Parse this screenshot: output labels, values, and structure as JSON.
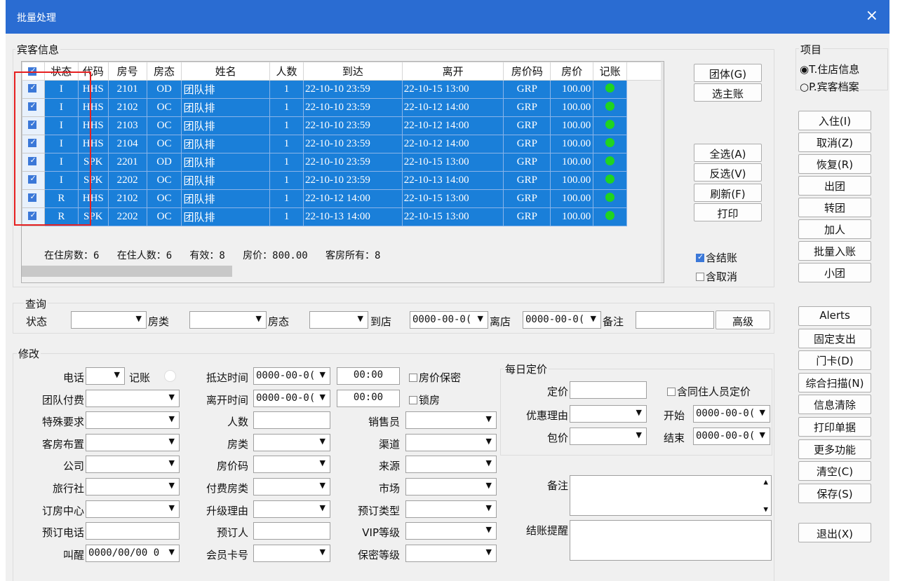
{
  "window": {
    "title": "批量处理",
    "close": "×"
  },
  "guest": {
    "legend": "宾客信息",
    "columns": [
      "状态",
      "代码",
      "房号",
      "房态",
      "姓名",
      "人数",
      "到达",
      "离开",
      "房价码",
      "房价",
      "记账"
    ],
    "rows": [
      [
        "I",
        "HHS",
        "2101",
        "OD",
        "团队排",
        "1",
        "22-10-10 23:59",
        "22-10-15 13:00",
        "GRP",
        "100.00"
      ],
      [
        "I",
        "HHS",
        "2102",
        "OC",
        "团队排",
        "1",
        "22-10-10 23:59",
        "22-10-12 14:00",
        "GRP",
        "100.00"
      ],
      [
        "I",
        "HHS",
        "2103",
        "OC",
        "团队排",
        "1",
        "22-10-10 23:59",
        "22-10-12 14:00",
        "GRP",
        "100.00"
      ],
      [
        "I",
        "HHS",
        "2104",
        "OC",
        "团队排",
        "1",
        "22-10-10 23:59",
        "22-10-12 14:00",
        "GRP",
        "100.00"
      ],
      [
        "I",
        "SPK",
        "2201",
        "OD",
        "团队排",
        "1",
        "22-10-10 23:59",
        "22-10-15 13:00",
        "GRP",
        "100.00"
      ],
      [
        "I",
        "SPK",
        "2202",
        "OC",
        "团队排",
        "1",
        "22-10-10 23:59",
        "22-10-13 14:00",
        "GRP",
        "100.00"
      ],
      [
        "R",
        "HHS",
        "2102",
        "OC",
        "团队排",
        "1",
        "22-10-12 14:00",
        "22-10-15 13:00",
        "GRP",
        "100.00"
      ],
      [
        "R",
        "SPK",
        "2202",
        "OC",
        "团队排",
        "1",
        "22-10-13 14:00",
        "22-10-15 13:00",
        "GRP",
        "100.00"
      ]
    ],
    "summary": "在住房数：6   在住人数：6   有效：8   房价：800.00   客房所有：8"
  },
  "side": {
    "group_btn": "团体(G)",
    "main_btn": "选主账",
    "select_all": "全选(A)",
    "invert": "反选(V)",
    "refresh": "刷新(F)",
    "print": "打印",
    "include_checkout": "含结账",
    "include_cancel": "含取消"
  },
  "project": {
    "legend": "项目",
    "opt1": "T.住店信息",
    "opt2": "P.宾客档案"
  },
  "actions": [
    "入住(I)",
    "取消(Z)",
    "恢复(R)",
    "出团",
    "转团",
    "加人",
    "批量入账",
    "小团"
  ],
  "actions2": [
    "Alerts",
    "固定支出",
    "门卡(D)",
    "综合扫描(N)",
    "信息清除",
    "打印单据",
    "更多功能",
    "清空(C)",
    "保存(S)"
  ],
  "exit_btn": "退出(X)",
  "query": {
    "legend": "查询",
    "status": "状态",
    "roomtype": "房类",
    "roomstate": "房态",
    "arrive": "到店",
    "arrive_val": "0000-00-0(",
    "leave": "离店",
    "leave_val": "0000-00-0(",
    "remark": "备注",
    "advanced": "高级"
  },
  "edit": {
    "legend": "修改",
    "phone": "电话",
    "billing": "记账",
    "pay": "团队付费",
    "special": "特殊要求",
    "layout": "客房布置",
    "company": "公司",
    "agency": "旅行社",
    "center": "订房中心",
    "bookphone": "预订电话",
    "wake": "叫醒",
    "wake_val": "0000/00/00 0",
    "arrtime": "抵达时间",
    "deptime": "离开时间",
    "date_val": "0000-00-0(",
    "time_val": "00:00",
    "secret": "房价保密",
    "lock": "锁房",
    "persons": "人数",
    "roomtype": "房类",
    "ratecode": "房价码",
    "paytype": "付费房类",
    "upgrade": "升级理由",
    "booker": "预订人",
    "member": "会员卡号",
    "sales": "销售员",
    "channel": "渠道",
    "source": "来源",
    "market": "市场",
    "booktype": "预订类型",
    "vip": "VIP等级",
    "secrecy": "保密等级",
    "remark": "备注",
    "reminder": "结账提醒"
  },
  "daily": {
    "legend": "每日定价",
    "price": "定价",
    "reason": "优惠理由",
    "package": "包价",
    "cohabit": "含同住人员定价",
    "start": "开始",
    "end": "结束",
    "date_val": "0000-00-0("
  }
}
